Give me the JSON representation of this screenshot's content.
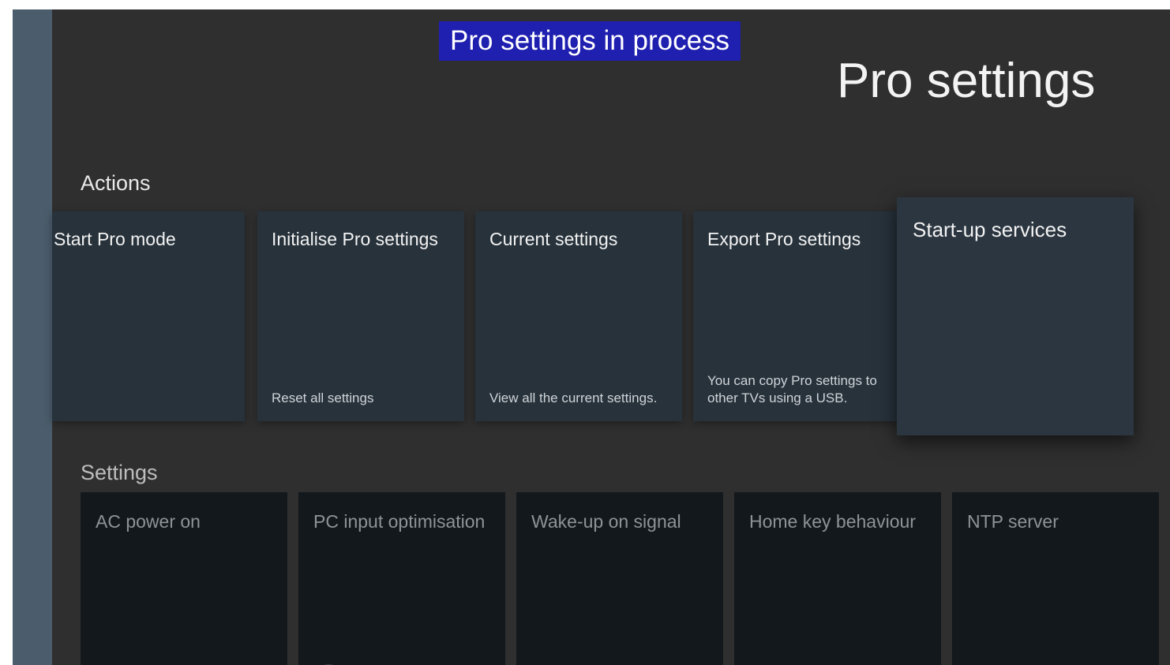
{
  "banner": {
    "text": "Pro settings in process"
  },
  "header": {
    "title": "Pro settings"
  },
  "actions": {
    "heading": "Actions",
    "cards": [
      {
        "title": "Start Pro mode",
        "description": ""
      },
      {
        "title": "Initialise Pro settings",
        "description": "Reset all settings"
      },
      {
        "title": "Current settings",
        "description": "View all the current settings."
      },
      {
        "title": "Export Pro settings",
        "description": "You can copy Pro settings to other TVs using a USB."
      },
      {
        "title": "Start-up services",
        "description": ""
      }
    ]
  },
  "settings": {
    "heading": "Settings",
    "cards": [
      {
        "title": "AC power on"
      },
      {
        "title": "PC input optimisation"
      },
      {
        "title": "Wake-up on signal"
      },
      {
        "title": "Home key behaviour"
      },
      {
        "title": "NTP server"
      }
    ]
  },
  "colors": {
    "background": "#2f2f2f",
    "rail": "#4b5d6c",
    "banner": "#1f1fb0",
    "action_card": "#27323b",
    "settings_card": "#13181c"
  }
}
